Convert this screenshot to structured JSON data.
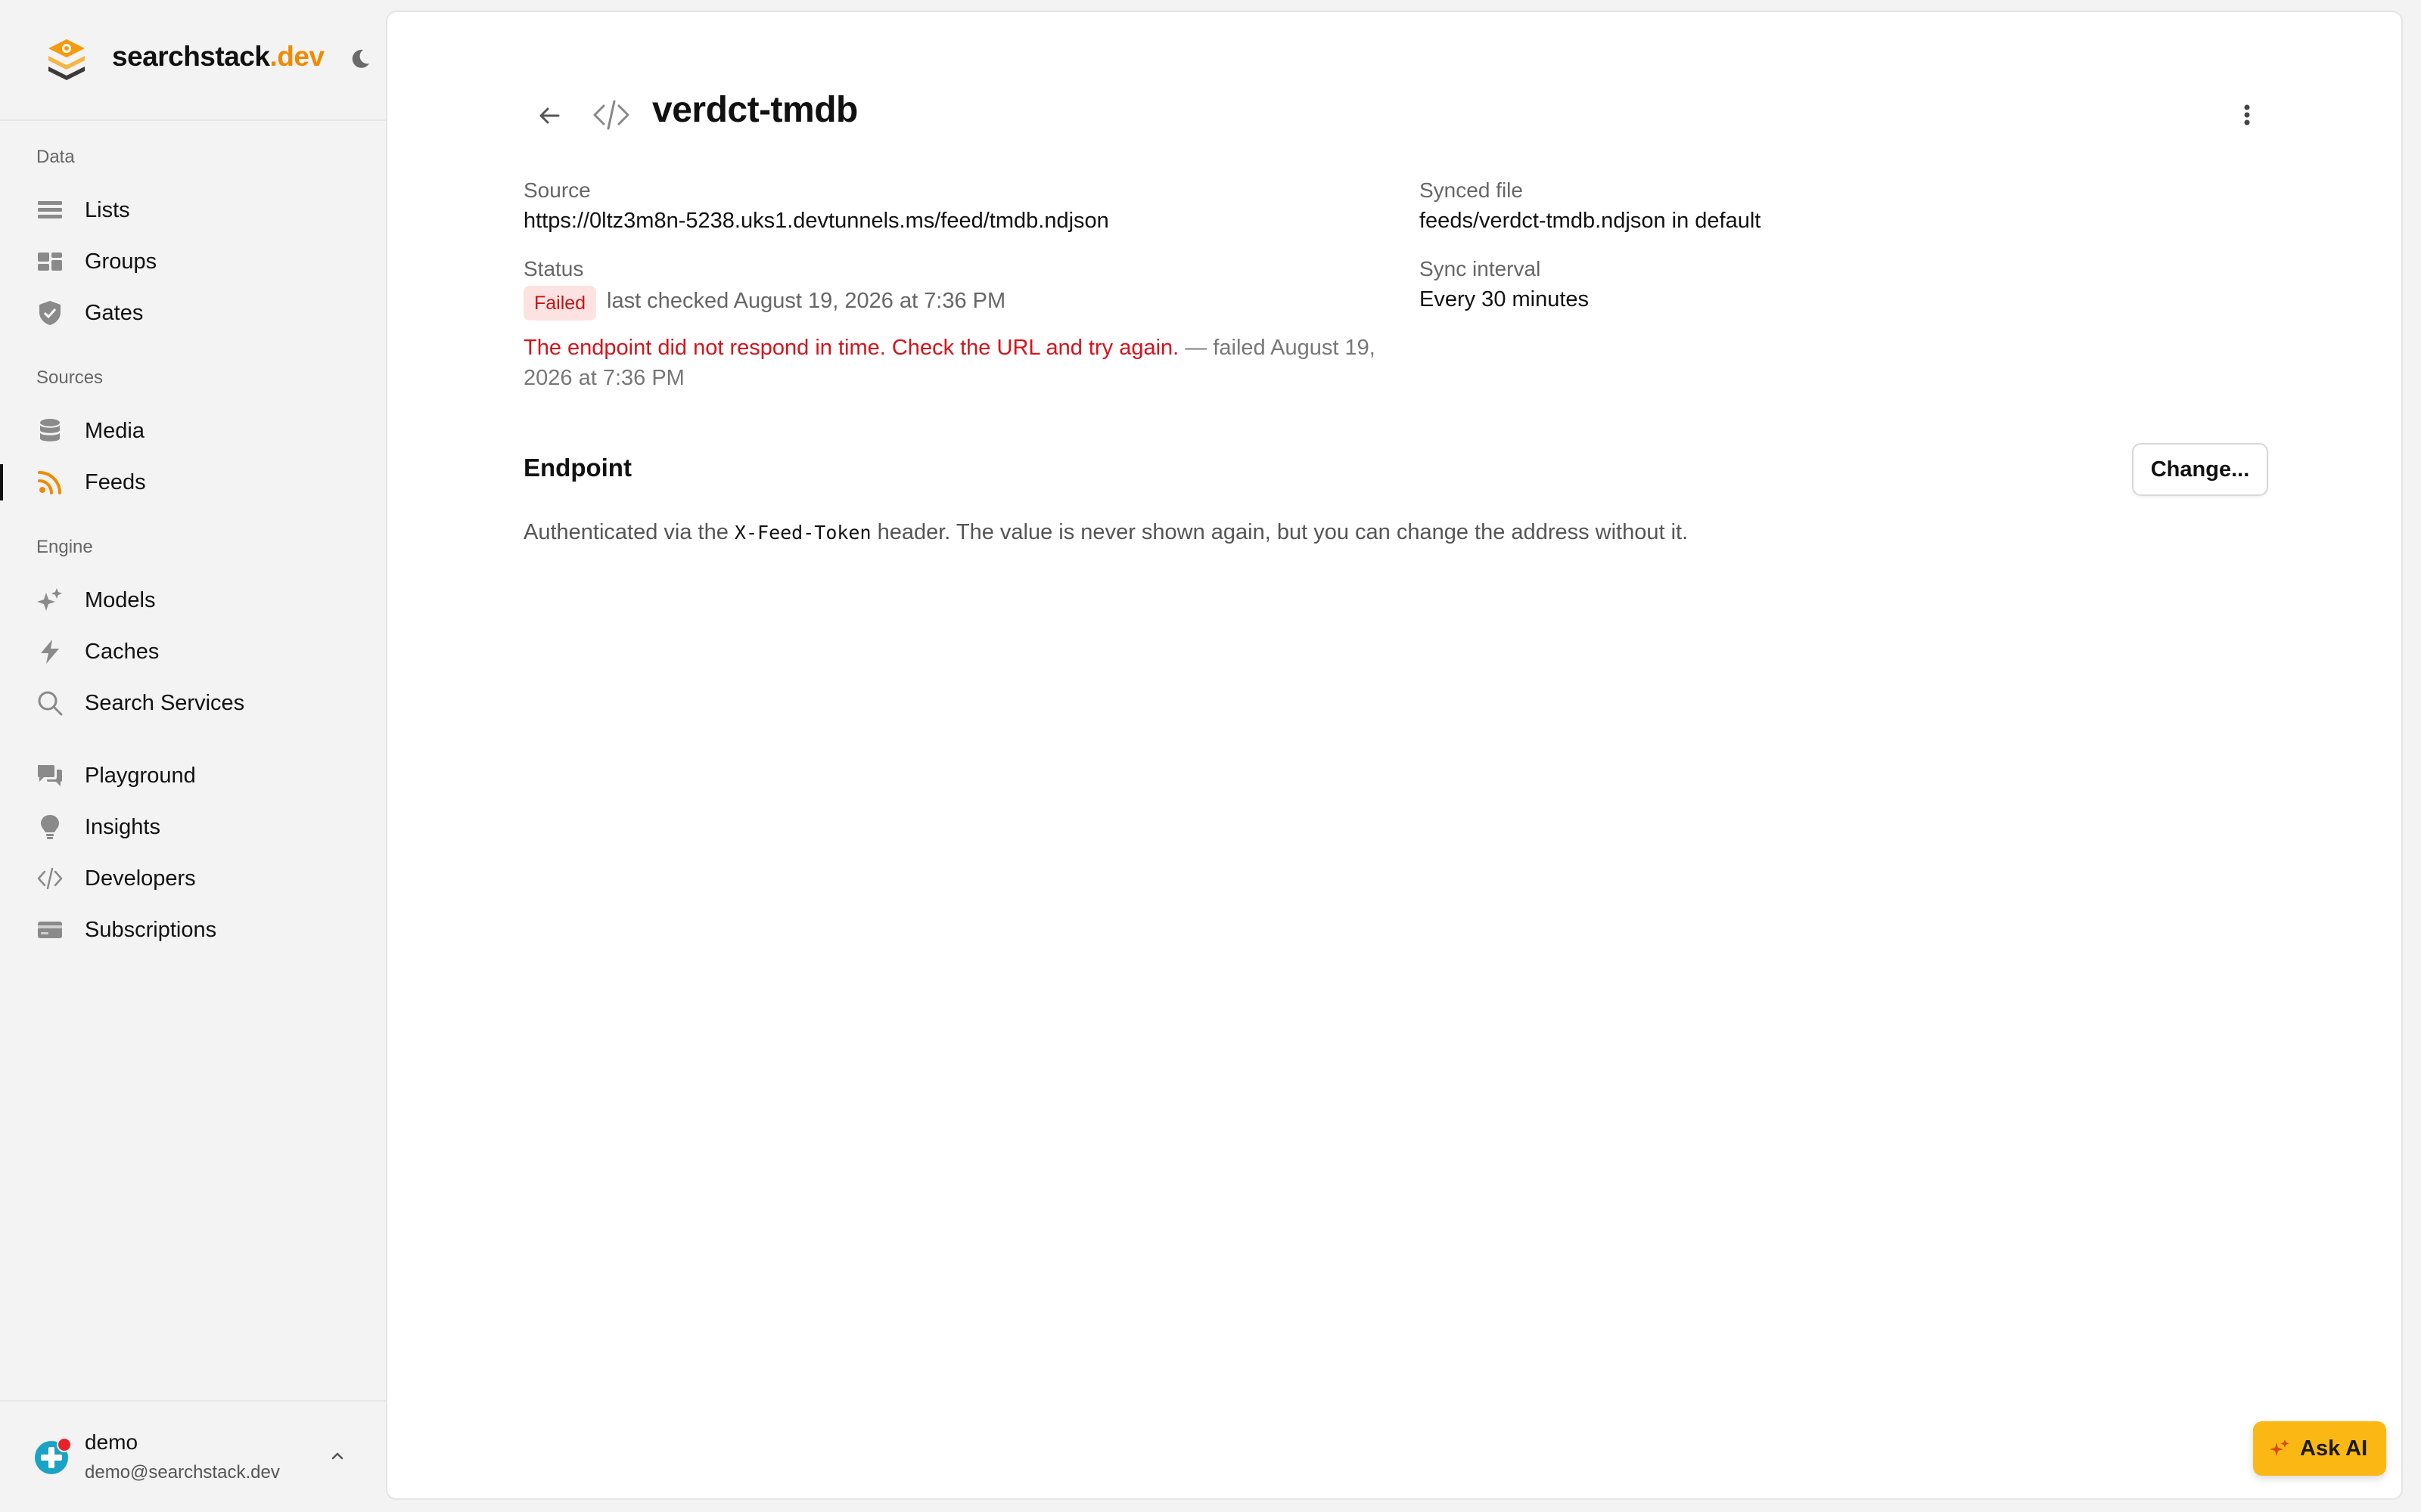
{
  "brand": {
    "name": "searchstack",
    "tld": ".dev",
    "accent": "#f08a00"
  },
  "sidebar": {
    "sections": [
      {
        "label": "Data",
        "items": [
          {
            "label": "Lists",
            "icon": "list-icon"
          },
          {
            "label": "Groups",
            "icon": "groups-icon"
          },
          {
            "label": "Gates",
            "icon": "shield-icon"
          }
        ]
      },
      {
        "label": "Sources",
        "items": [
          {
            "label": "Media",
            "icon": "database-icon"
          },
          {
            "label": "Feeds",
            "icon": "rss-icon",
            "active": true
          }
        ]
      },
      {
        "label": "Engine",
        "items": [
          {
            "label": "Models",
            "icon": "sparkles-icon"
          },
          {
            "label": "Caches",
            "icon": "bolt-icon"
          },
          {
            "label": "Search Services",
            "icon": "search-icon"
          }
        ]
      },
      {
        "label": "",
        "items": [
          {
            "label": "Playground",
            "icon": "chat-bubbles-icon"
          },
          {
            "label": "Insights",
            "icon": "lightbulb-icon"
          },
          {
            "label": "Developers",
            "icon": "code-icon"
          },
          {
            "label": "Subscriptions",
            "icon": "credit-card-icon"
          }
        ]
      }
    ]
  },
  "user": {
    "name": "demo",
    "email": "demo@searchstack.dev"
  },
  "page": {
    "title": "verdct-tmdb",
    "source_label": "Source",
    "source_value": "https://0ltz3m8n-5238.uks1.devtunnels.ms/feed/tmdb.ndjson",
    "synced_label": "Synced file",
    "synced_value": "feeds/verdct-tmdb.ndjson in default",
    "status_label": "Status",
    "status_badge": "Failed",
    "status_checked": "last checked August 19, 2026 at 7:36 PM",
    "interval_label": "Sync interval",
    "interval_value": "Every 30 minutes",
    "error_message": "The endpoint did not respond in time. Check the URL and try again.",
    "error_suffix": " — failed August 19, 2026 at 7:36 PM"
  },
  "endpoint": {
    "title": "Endpoint",
    "change_label": "Change...",
    "desc_prefix": "Authenticated via the ",
    "desc_code": "X-Feed-Token",
    "desc_suffix": " header. The value is never shown again, but you can change the address without it."
  },
  "ask_ai": {
    "label": "Ask AI"
  },
  "colors": {
    "error": "#d5131b",
    "badge_bg": "#fde2e2",
    "ask_ai_bg": "#fbb814"
  }
}
